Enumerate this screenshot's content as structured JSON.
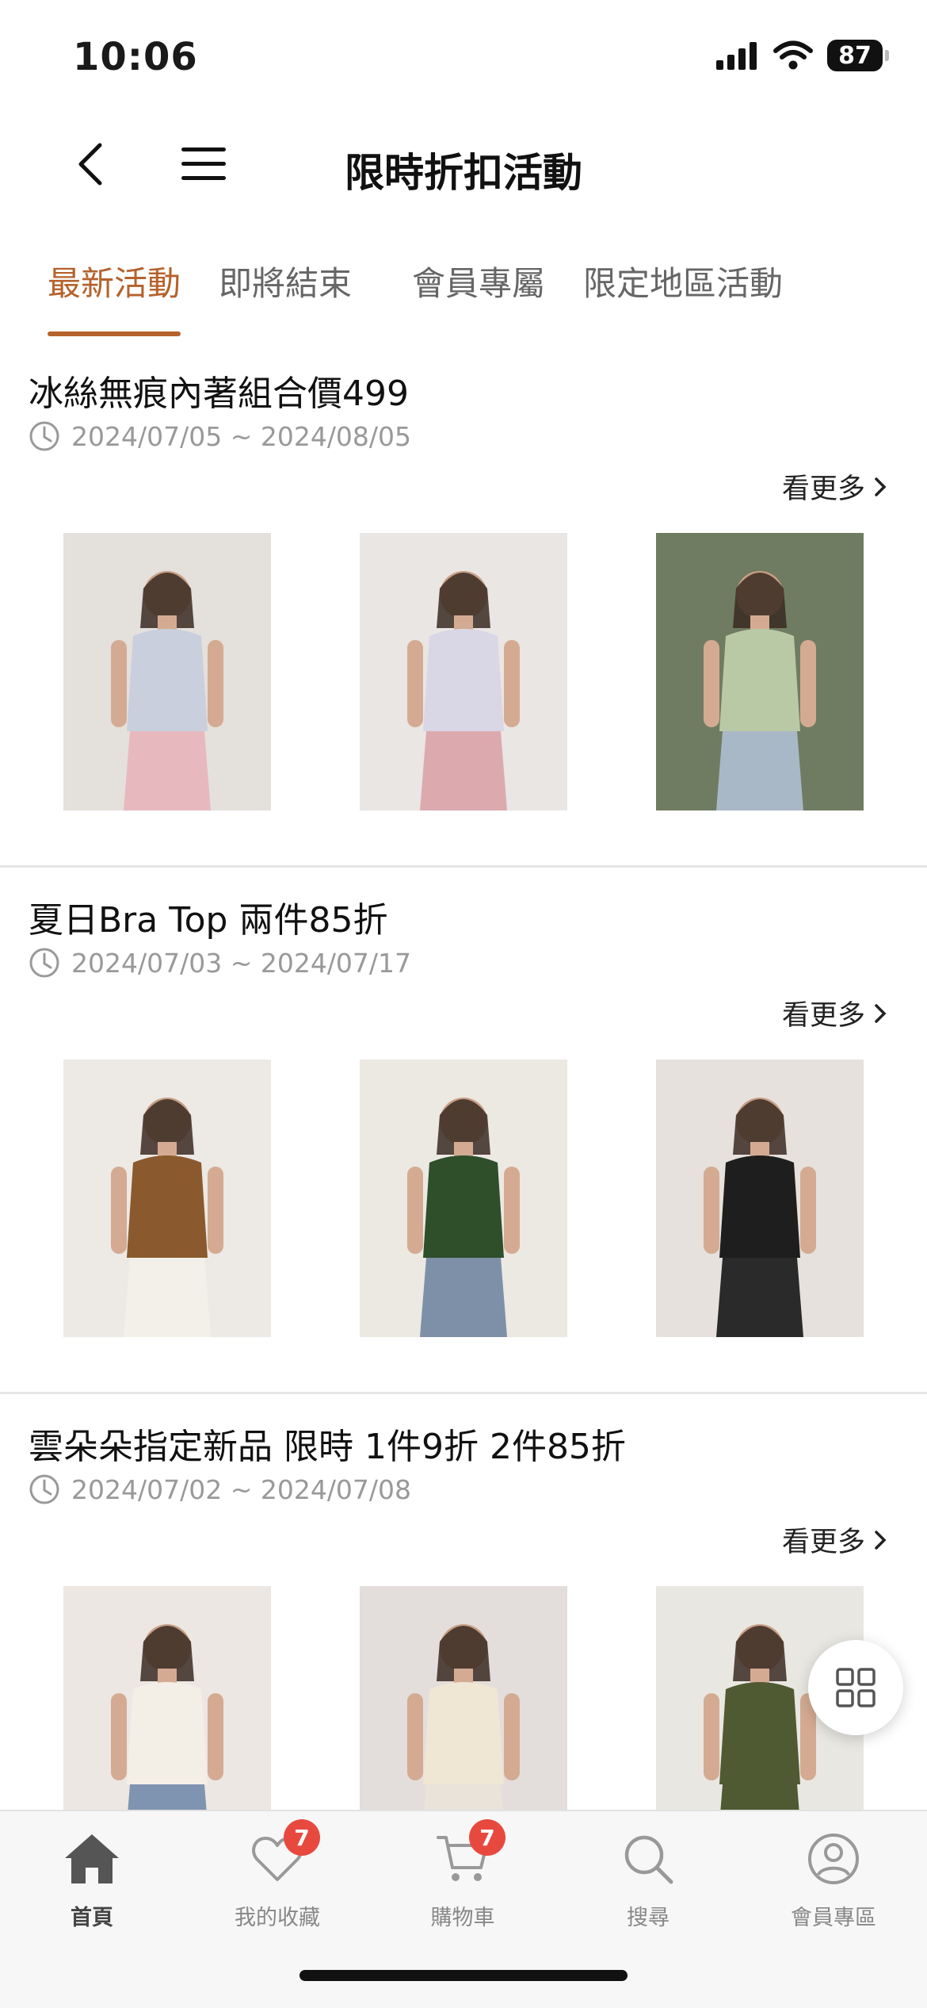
{
  "status_bar": {
    "time": "10:06",
    "battery": "87"
  },
  "nav": {
    "title": "限時折扣活動",
    "back_icon": "chevron-left-icon",
    "menu_icon": "hamburger-menu-icon"
  },
  "tabs": [
    {
      "label": "最新活動",
      "active": true
    },
    {
      "label": "即將結束",
      "active": false
    },
    {
      "label": "會員專屬",
      "active": false
    },
    {
      "label": "限定地區活動",
      "active": false
    }
  ],
  "campaigns": [
    {
      "title": "冰絲無痕內著組合價499",
      "date": "2024/07/05 ~ 2024/08/05",
      "see_more": "看更多",
      "products": [
        {
          "tone": "#e4e0dc",
          "garment": "#c9cfdc",
          "alt_garment": "#e7b9bf"
        },
        {
          "tone": "#e9e6e4",
          "garment": "#d9d6e6",
          "alt_garment": "#dcaaae"
        },
        {
          "tone": "#6f7c62",
          "garment": "#b9c9a6",
          "alt_garment": "#a9b8c6"
        }
      ]
    },
    {
      "title": "夏日Bra Top 兩件85折",
      "date": "2024/07/03 ~ 2024/07/17",
      "see_more": "看更多",
      "products": [
        {
          "tone": "#ede9e5",
          "garment": "#8a5a2e",
          "alt_garment": "#f3f0ea"
        },
        {
          "tone": "#ece8e2",
          "garment": "#2e4f2a",
          "alt_garment": "#7d90a8"
        },
        {
          "tone": "#e6e1dc",
          "garment": "#1e1e1e",
          "alt_garment": "#2a2a2a"
        }
      ]
    },
    {
      "title": "雲朵朵指定新品 限時  1件9折 2件85折",
      "date": "2024/07/02 ~ 2024/07/08",
      "see_more": "看更多",
      "products": [
        {
          "tone": "#ece7e2",
          "garment": "#f4efe6",
          "alt_garment": "#7f94b0"
        },
        {
          "tone": "#e3dedb",
          "garment": "#efe6d4",
          "alt_garment": "#e9e3da"
        },
        {
          "tone": "#e9e7e2",
          "garment": "#4f5a33",
          "alt_garment": "#4f5a33"
        }
      ]
    }
  ],
  "fab_icon": "grid-icon",
  "tabbar": [
    {
      "label": "首頁",
      "icon": "home-icon",
      "active": true,
      "badge": ""
    },
    {
      "label": "我的收藏",
      "icon": "heart-icon",
      "active": false,
      "badge": "7"
    },
    {
      "label": "購物車",
      "icon": "cart-icon",
      "active": false,
      "badge": "7"
    },
    {
      "label": "搜尋",
      "icon": "search-icon",
      "active": false,
      "badge": ""
    },
    {
      "label": "會員專區",
      "icon": "user-icon",
      "active": false,
      "badge": ""
    }
  ],
  "colors": {
    "accent": "#b5622c",
    "badge": "#e8493f",
    "muted": "#999999"
  }
}
